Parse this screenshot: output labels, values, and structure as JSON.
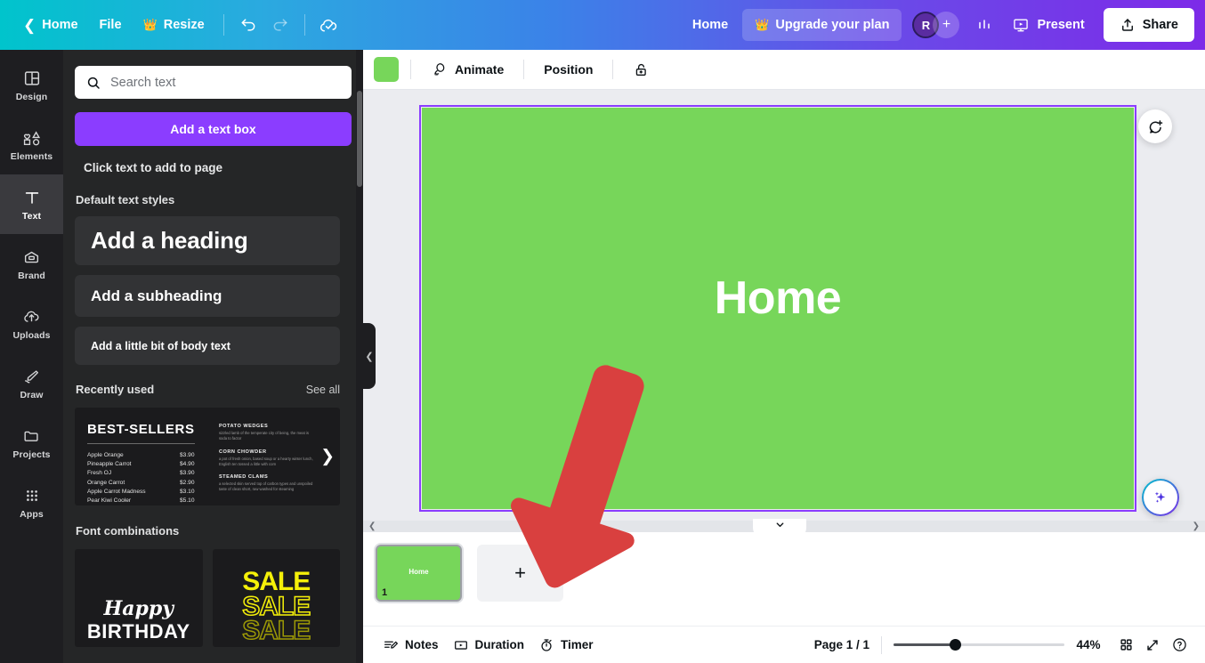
{
  "topbar": {
    "back_icon": "chevron-left-icon",
    "home_label": "Home",
    "file_label": "File",
    "resize_label": "Resize",
    "resize_badge_icon": "crown-icon",
    "undo_icon": "undo-icon",
    "redo_icon": "redo-icon",
    "cloud_icon": "cloud-saved-icon",
    "home_link_label": "Home",
    "upgrade_label": "Upgrade your plan",
    "upgrade_icon": "crown-icon",
    "avatar_initial": "R",
    "avatar_add_label": "+",
    "insights_icon": "insights-bar-chart-icon",
    "present_label": "Present",
    "present_icon": "present-screen-icon",
    "share_label": "Share",
    "share_icon": "share-upload-icon",
    "gradient_start": "#00c4cc",
    "gradient_end": "#7d2ae8"
  },
  "rail": {
    "items": [
      {
        "label": "Design",
        "icon": "design-layout-icon",
        "active": false
      },
      {
        "label": "Elements",
        "icon": "elements-shapes-icon",
        "active": false
      },
      {
        "label": "Text",
        "icon": "text-t-icon",
        "active": true
      },
      {
        "label": "Brand",
        "icon": "brand-kit-icon",
        "active": false
      },
      {
        "label": "Uploads",
        "icon": "uploads-cloud-icon",
        "active": false
      },
      {
        "label": "Draw",
        "icon": "draw-pen-icon",
        "active": false
      },
      {
        "label": "Projects",
        "icon": "projects-folder-icon",
        "active": false
      },
      {
        "label": "Apps",
        "icon": "apps-grid-icon",
        "active": false
      }
    ]
  },
  "panel": {
    "search_placeholder": "Search text",
    "search_value": "",
    "search_icon": "search-icon",
    "add_text_box_label": "Add a text box",
    "click_hint": "Click text to add to page",
    "default_styles_title": "Default text styles",
    "styles": [
      {
        "label": "Add a heading"
      },
      {
        "label": "Add a subheading"
      },
      {
        "label": "Add a little bit of body text"
      }
    ],
    "recently_used_title": "Recently used",
    "see_all_label": "See all",
    "recent_card": {
      "title": "BEST-SELLERS",
      "rows": [
        {
          "name": "Apple Orange",
          "price": "$3.90"
        },
        {
          "name": "Pineapple Carrot",
          "price": "$4.90"
        },
        {
          "name": "Fresh OJ",
          "price": "$3.90"
        },
        {
          "name": "Orange Carrot",
          "price": "$2.90"
        },
        {
          "name": "Apple Carrot Madness",
          "price": "$3.10"
        },
        {
          "name": "Pear Kiwi Cooler",
          "price": "$5.10"
        }
      ],
      "items": [
        {
          "head": "POTATO WEDGES",
          "body": "sizzled lamb of the temperate city of being, the meat is soda to factor"
        },
        {
          "head": "CORN CHOWDER",
          "body": "a pot of fresh onion, based soup or a hearty winter lunch, English ten tossed a little with corn"
        },
        {
          "head": "STEAMED CLAMS",
          "body": "a selected skin served top of carbon types and unspoiled taste of clean short, raw washed for steaming"
        }
      ],
      "next_icon": "chevron-right-icon"
    },
    "font_combinations_title": "Font combinations",
    "combos": [
      {
        "line1": "Happy",
        "line2": "BIRTHDAY"
      },
      {
        "line1": "SALE",
        "line2": "SALE",
        "line3": "SALE"
      }
    ],
    "collapse_icon": "chevron-left-icon"
  },
  "editor_toolbar": {
    "color_swatch": "#77d65a",
    "animate_label": "Animate",
    "animate_icon": "animate-icon",
    "position_label": "Position",
    "lock_icon": "unlock-icon"
  },
  "canvas": {
    "page_text": "Home",
    "page_background": "#77d65a",
    "selection_color": "#8b3dff",
    "comment_icon": "add-comment-icon",
    "magic_icon": "magic-sparkles-icon",
    "scroll_left_icon": "chevron-left-icon",
    "scroll_right_icon": "chevron-right-icon"
  },
  "pages_strip": {
    "toggle_icon": "chevron-down-icon",
    "thumbnails": [
      {
        "number": "1",
        "text": "Home",
        "selected": true
      }
    ],
    "add_page_label": "+"
  },
  "bottombar": {
    "notes_label": "Notes",
    "notes_icon": "notes-icon",
    "duration_label": "Duration",
    "duration_icon": "duration-play-icon",
    "timer_label": "Timer",
    "timer_icon": "timer-stopwatch-icon",
    "page_count": "Page 1 / 1",
    "zoom_value": "44%",
    "grid_icon": "grid-view-icon",
    "fullscreen_icon": "fullscreen-expand-icon",
    "help_icon": "help-question-icon"
  },
  "annotation": {
    "arrow_color": "#d9403f",
    "arrow_target": "add-page-button"
  }
}
